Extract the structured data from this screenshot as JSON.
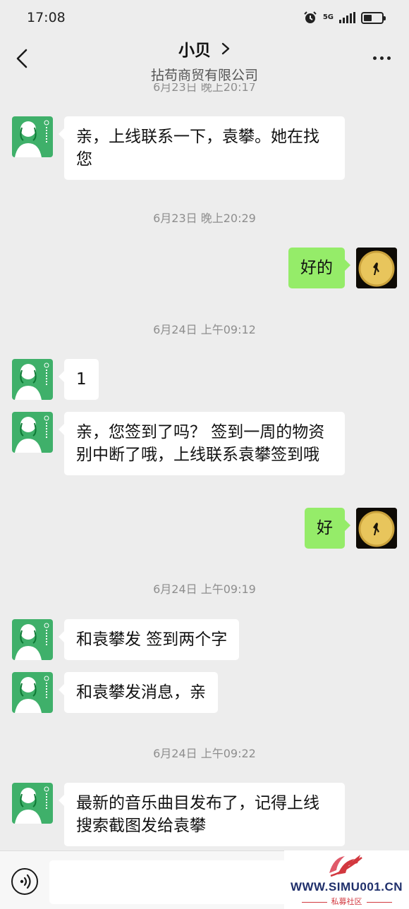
{
  "status_bar": {
    "time": "17:08",
    "network": "5G"
  },
  "header": {
    "contact_name": "小贝",
    "company": "拈苟商贸有限公司"
  },
  "chat": {
    "timestamps": {
      "t0": "6月23日 晚上20:17",
      "t1": "6月23日 晚上20:29",
      "t2": "6月24日 上午09:12",
      "t3": "6月24日 上午09:19",
      "t4": "6月24日 上午09:22"
    },
    "messages": {
      "m1": {
        "sender": "contact",
        "text": "亲，上线联系一下，袁攀。她在找您"
      },
      "m2": {
        "sender": "me",
        "text": "好的"
      },
      "m3": {
        "sender": "contact",
        "text": "1"
      },
      "m4": {
        "sender": "contact",
        "text": "亲，您签到了吗？ 签到一周的物资别中断了哦，上线联系袁攀签到哦"
      },
      "m5": {
        "sender": "me",
        "text": "好"
      },
      "m6": {
        "sender": "contact",
        "text": "和袁攀发 签到两个字"
      },
      "m7": {
        "sender": "contact",
        "text": "和袁攀发消息，亲"
      },
      "m8": {
        "sender": "contact",
        "text": "最新的音乐曲目发布了，记得上线搜索截图发给袁攀"
      }
    }
  },
  "input_bar": {
    "placeholder": ""
  },
  "watermark": {
    "url": "WWW.SIMU001.CN",
    "label": "私募社区"
  },
  "colors": {
    "background": "#ededed",
    "incoming_bubble": "#ffffff",
    "outgoing_bubble": "#95ec69",
    "contact_avatar": "#3fb06a"
  }
}
